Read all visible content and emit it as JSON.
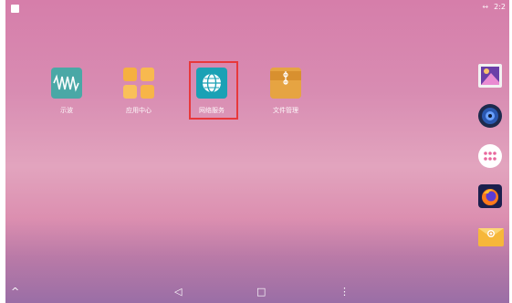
{
  "status_bar": {
    "network": "↔",
    "time": "2:2"
  },
  "apps": [
    {
      "label": "示波",
      "icon": "waveform-icon"
    },
    {
      "label": "应用中心",
      "icon": "app-grid-icon"
    },
    {
      "label": "网络服务",
      "icon": "globe-icon"
    },
    {
      "label": "文件管理",
      "icon": "folder-icon"
    }
  ],
  "selected_app": "网络服务",
  "dock": [
    {
      "icon": "gallery-icon"
    },
    {
      "icon": "speaker-icon"
    },
    {
      "icon": "app-drawer-icon"
    },
    {
      "icon": "firefox-icon"
    },
    {
      "icon": "email-icon"
    }
  ],
  "navigation": {
    "up": "^",
    "back": "◁",
    "home": "□",
    "menu": "⋮"
  },
  "colors": {
    "highlight": "#e8383b",
    "oscilloscope": "#4aa8a6",
    "app_center": "#f8b64a",
    "network": "#1aa1b5",
    "files": "#e6a442"
  }
}
